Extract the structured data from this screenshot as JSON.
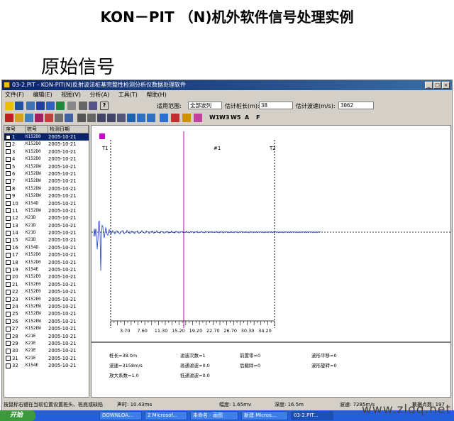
{
  "slide": {
    "title": "KON－PIT （N)机外软件信号处理实例",
    "subtitle": "原始信号"
  },
  "window": {
    "title": "03-2.PIT - KON-PIT(N)反射波法桩基完整性检测分析仪数据处理软件",
    "controls": [
      "_",
      "□",
      "×"
    ]
  },
  "menu": [
    "文件(F)",
    "编辑(E)",
    "视图(V)",
    "分析(A)",
    "工具(T)",
    "帮助(H)"
  ],
  "toolbar": {
    "range_label": "适用范围:",
    "range_value": "全部波列",
    "length_label": "估计桩长(m):",
    "length_value": "38",
    "speed_label": "估计波速(m/s):",
    "speed_value": "3062",
    "w_buttons": [
      "W1",
      "W3",
      "W5",
      "A",
      "F"
    ]
  },
  "list": {
    "headers": [
      "序号",
      "桩号",
      "检测日期"
    ],
    "rows": [
      {
        "n": "1",
        "id": "K152D0",
        "date": "2005-10-21"
      },
      {
        "n": "2",
        "id": "K152D0",
        "date": "2005-10-21"
      },
      {
        "n": "3",
        "id": "K152D0",
        "date": "2005-10-21"
      },
      {
        "n": "4",
        "id": "K152D0",
        "date": "2005-10-21"
      },
      {
        "n": "5",
        "id": "K152DW",
        "date": "2005-10-21"
      },
      {
        "n": "6",
        "id": "K152DW",
        "date": "2005-10-21"
      },
      {
        "n": "7",
        "id": "K152DW",
        "date": "2005-10-21"
      },
      {
        "n": "8",
        "id": "K152DW",
        "date": "2005-10-21"
      },
      {
        "n": "9",
        "id": "K152DW",
        "date": "2005-10-21"
      },
      {
        "n": "10",
        "id": "K154D",
        "date": "2005-10-21"
      },
      {
        "n": "11",
        "id": "K152DW",
        "date": "2005-10-21"
      },
      {
        "n": "12",
        "id": "K21D",
        "date": "2005-10-21"
      },
      {
        "n": "13",
        "id": "K21D",
        "date": "2005-10-21"
      },
      {
        "n": "14",
        "id": "K21D",
        "date": "2005-10-21"
      },
      {
        "n": "15",
        "id": "K21D",
        "date": "2005-10-21"
      },
      {
        "n": "16",
        "id": "K154D",
        "date": "2005-10-21"
      },
      {
        "n": "17",
        "id": "K152D0",
        "date": "2005-10-21"
      },
      {
        "n": "18",
        "id": "K152D0",
        "date": "2005-10-21"
      },
      {
        "n": "19",
        "id": "K154E",
        "date": "2005-10-21"
      },
      {
        "n": "20",
        "id": "K152E0",
        "date": "2005-10-21"
      },
      {
        "n": "21",
        "id": "K152E0",
        "date": "2005-10-21"
      },
      {
        "n": "22",
        "id": "K152E0",
        "date": "2005-10-21"
      },
      {
        "n": "23",
        "id": "K152E0",
        "date": "2005-10-21"
      },
      {
        "n": "24",
        "id": "K152EW",
        "date": "2005-10-21"
      },
      {
        "n": "25",
        "id": "K152EW",
        "date": "2005-10-21"
      },
      {
        "n": "26",
        "id": "K152EW",
        "date": "2005-10-21"
      },
      {
        "n": "27",
        "id": "K152EW",
        "date": "2005-10-21"
      },
      {
        "n": "28",
        "id": "K21E",
        "date": "2005-10-21"
      },
      {
        "n": "29",
        "id": "K21E",
        "date": "2005-10-21"
      },
      {
        "n": "30",
        "id": "K21E",
        "date": "2005-10-21"
      },
      {
        "n": "31",
        "id": "K21E",
        "date": "2005-10-21"
      },
      {
        "n": "32",
        "id": "K154E",
        "date": "2005-10-21"
      }
    ]
  },
  "plot": {
    "marker_t1": "T1",
    "marker_t2": "T2",
    "marker_1": "#1",
    "ticks": [
      "3.70",
      "7.60",
      "11.30",
      "15.20",
      "19.20",
      "22.70",
      "26.70",
      "30.30",
      "34.20"
    ],
    "info": [
      [
        "桩长=38.0m",
        "滤波次数=1",
        "前置零=0",
        "波形平移=0"
      ],
      [
        "波速=3158m/s",
        "高通滤波=0.0",
        "后截除=0",
        "波形旋转=0"
      ],
      [
        "放大系数=1.0",
        "低通滤波=0.0",
        "",
        ""
      ]
    ],
    "colors": {
      "signal": "#1f3fbf",
      "cursor": "#c030c0",
      "marker": "#cc00cc"
    }
  },
  "status": {
    "hint": "按鼠标右键在当前位置设置桩头、桩底或缺陷",
    "time": "声时: 10.43ms",
    "amp": "幅度: 1.65mv",
    "depth": "深度: 16.5m",
    "speed": "波速: 7285m/s",
    "count": "数据点数: 197"
  },
  "taskbar": {
    "start": "开始",
    "items": [
      "DOWNLOA...",
      "2 Microsof...",
      "未命名 - 画图",
      "新建 Micros...",
      "03-2.PIT..."
    ]
  },
  "watermark": "www.zldq.net"
}
